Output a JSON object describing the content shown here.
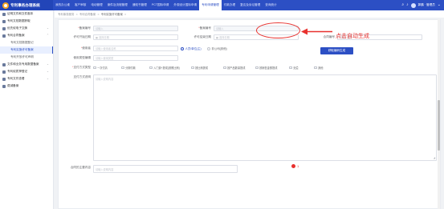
{
  "app": {
    "title": "专利事务办理系统"
  },
  "nav": {
    "items": [
      "我的办公桌",
      "客户审核",
      "电动管理",
      "案件及流程管理",
      "通知书管理",
      "PCT国际申请",
      "外观设计国际申请",
      "专利申请管理",
      "付款办理",
      "复议及诉讼管理",
      "查询统计"
    ],
    "active_index": 7
  },
  "user": {
    "name": "郭鹏 · 管理员"
  },
  "sidebar": {
    "items": [
      {
        "label": "证明文件和文件副本",
        "type": "group"
      },
      {
        "label": "专利文档数据获取",
        "type": "group"
      },
      {
        "label": "优先权电子交换",
        "type": "group",
        "chevron": "⌄"
      },
      {
        "label": "专利合同备案",
        "type": "group",
        "chevron": "⌃"
      },
      {
        "label": "专利文档数据登记",
        "type": "sub"
      },
      {
        "label": "专利实施许可备案",
        "type": "sub",
        "active": true
      },
      {
        "label": "专利开放许可声明",
        "type": "sub"
      },
      {
        "label": "文件和业务专用数据备案",
        "type": "group",
        "chevron": "⌄"
      },
      {
        "label": "专利权质押登记",
        "type": "group",
        "chevron": "⌄"
      },
      {
        "label": "专利文件查看",
        "type": "group",
        "chevron": "⌄"
      },
      {
        "label": "费减备案",
        "type": "group"
      }
    ]
  },
  "breadcrumb": {
    "items": [
      "专利事务服务",
      "专利合同备案",
      "专利实施许可备案"
    ]
  },
  "form": {
    "contract_no": {
      "label": "备案编号",
      "placeholder": "请输入"
    },
    "apply_no": {
      "label": "备案编号",
      "placeholder": "请输入"
    },
    "start_date": {
      "label": "许可开始日期",
      "placeholder": "选择日期"
    },
    "end_date": {
      "label": "许可结束日期",
      "placeholder": "选择日期"
    },
    "reg_no": {
      "label": "合同编号",
      "placeholder": "请输入编号"
    },
    "user": {
      "label": "使用者",
      "placeholder": "请输入使用者名称"
    },
    "user_type": {
      "options": [
        "人员/单位(主)",
        "非公司(其他)"
      ],
      "selected_index": 0
    },
    "license_type": {
      "label": "使用类型编辑",
      "placeholder": "请输入使用类型"
    },
    "methods": {
      "label": "支付方式类型",
      "options": [
        "一次付清",
        "分期付款",
        "入门费+提成(按照比例)",
        "按比例提成",
        "按产品数量提成",
        "按销售金额提成",
        "无偿",
        "其他"
      ]
    },
    "detail": {
      "label": "支付方式说明",
      "placeholder": "请输入说明内容"
    },
    "other": {
      "label": "合同的主要内容",
      "placeholder": "请输入说明内容"
    },
    "generate_button": "获取编码生成"
  },
  "annotation": {
    "text": "点击自动生成",
    "count": "1"
  },
  "colors": {
    "brand": "#2c4fc4",
    "annotation": "#e8312e"
  }
}
